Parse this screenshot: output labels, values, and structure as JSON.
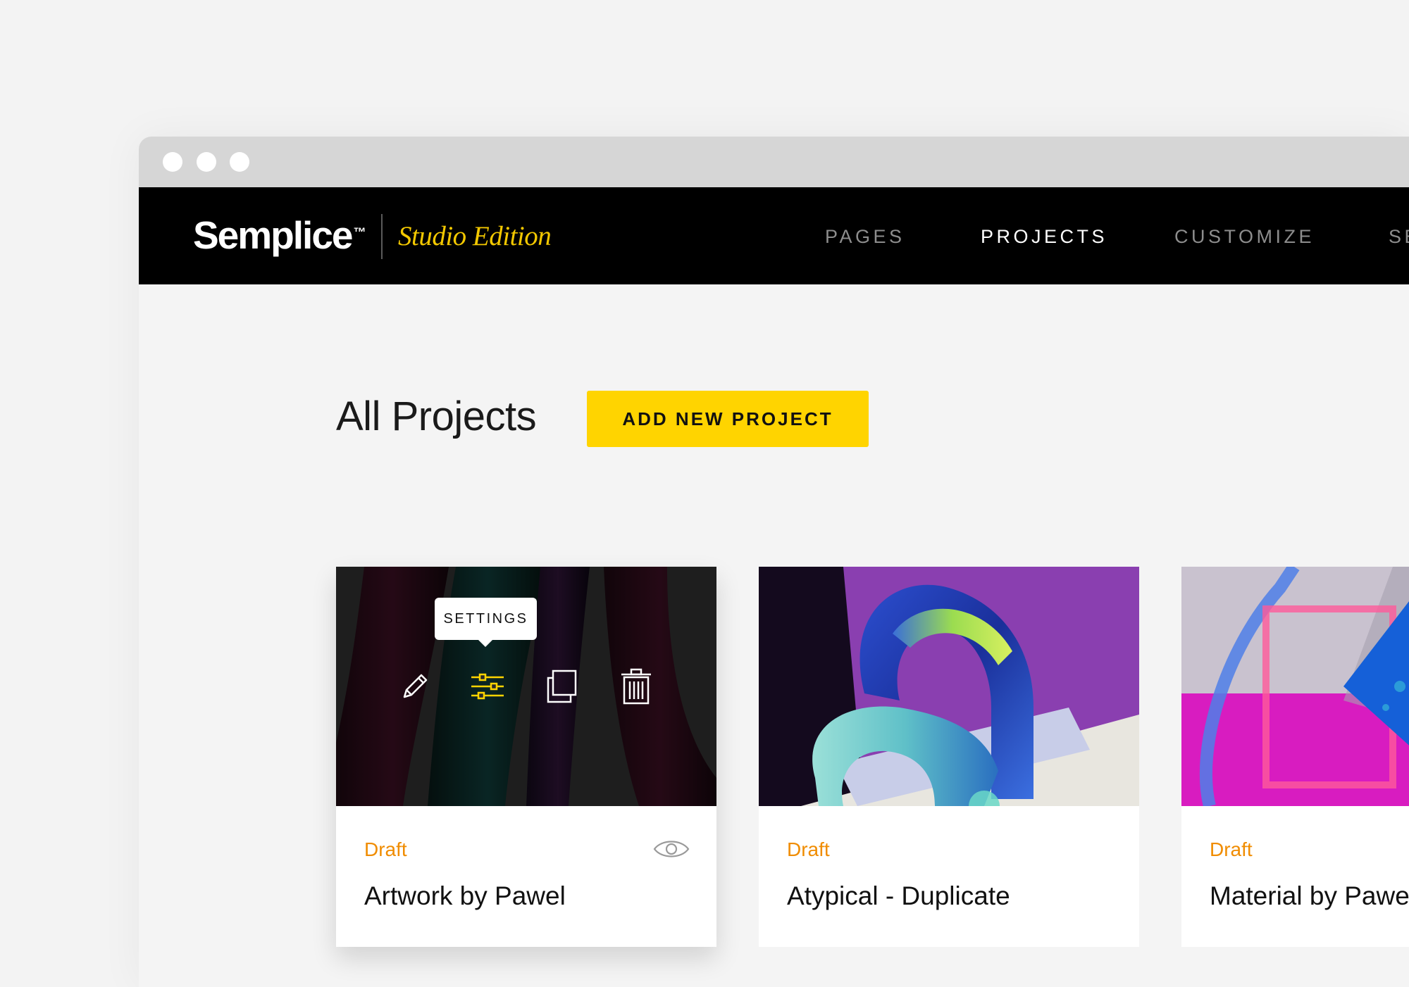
{
  "window": {
    "dots": [
      "close",
      "minimize",
      "maximize"
    ]
  },
  "navbar": {
    "logo": "Semplice",
    "trademark": "™",
    "edition": "Studio Edition",
    "items": [
      {
        "label": "PAGES",
        "active": false
      },
      {
        "label": "PROJECTS",
        "active": true
      },
      {
        "label": "CUSTOMIZE",
        "active": false
      },
      {
        "label": "SE",
        "active": false
      }
    ]
  },
  "main": {
    "title": "All Projects",
    "add_button": "ADD NEW PROJECT"
  },
  "projects": [
    {
      "status": "Draft",
      "title": "Artwork by Pawel",
      "hovered": true,
      "tooltip": "SETTINGS",
      "actions": [
        "pencil-icon",
        "sliders-icon",
        "duplicate-icon",
        "trash-icon"
      ],
      "preview_icon": "eye-icon"
    },
    {
      "status": "Draft",
      "title": "Atypical - Duplicate"
    },
    {
      "status": "Draft",
      "title": "Material by Pawe"
    }
  ],
  "colors": {
    "accent": "#ffd400",
    "edition_gold": "#f3c800",
    "draft_orange": "#f08c00",
    "navbar_bg": "#000000",
    "nav_inactive": "#8d8d8d"
  }
}
